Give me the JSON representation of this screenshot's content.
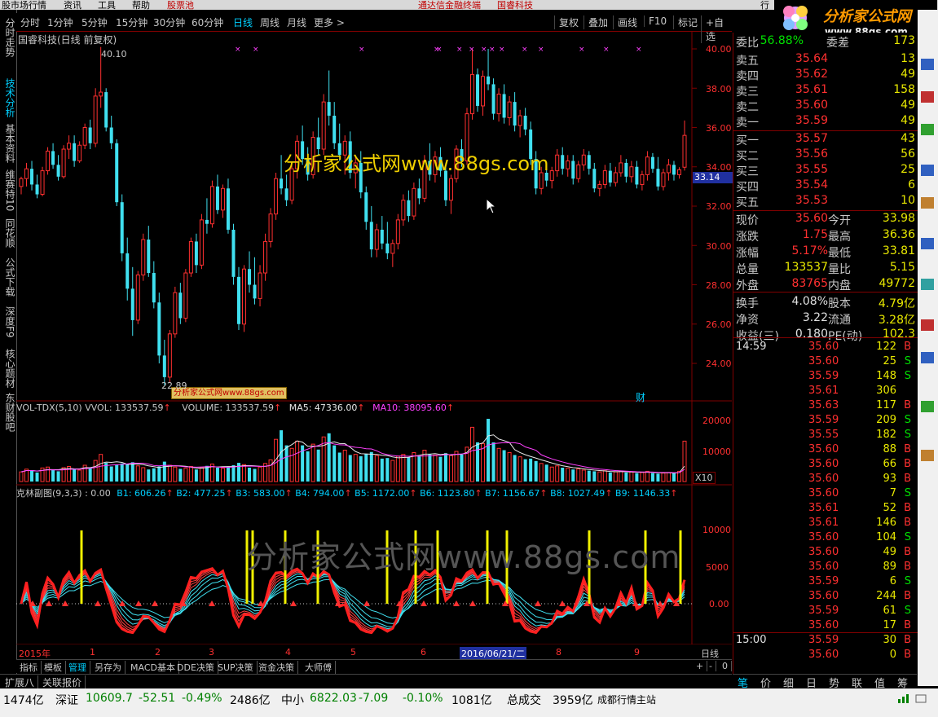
{
  "topbar": {
    "items": [
      "股市场行情",
      "资讯",
      "工具",
      "帮助",
      "股票池",
      "通达信金融终端",
      "国睿科技",
      "行"
    ]
  },
  "lefttabs": [
    "分时走势",
    "技术分析",
    "基本资料",
    "维赛特10",
    "同花顺",
    "公式下载",
    "深度F9",
    "核心题材",
    "东财股吧"
  ],
  "periods": [
    "分时",
    "1分钟",
    "5分钟",
    "15分钟",
    "30分钟",
    "60分钟",
    "日线",
    "周线",
    "月线",
    "更多 >"
  ],
  "rightbtns": [
    "复权",
    "叠加",
    "画线",
    "F10",
    "标记",
    "+自选"
  ],
  "stock_title": "国睿科技(日线 前复权)",
  "watermark": "分析家公式网www.88gs.com",
  "watermark_bottom": "分析家公式网www.88gs.com",
  "small_watermark": "分析家公式网www.88gs.com",
  "price_axis": [
    "40.00",
    "38.00",
    "36.00",
    "34.00",
    "32.00",
    "30.00",
    "28.00",
    "26.00",
    "24.00"
  ],
  "current_price_tag": "33.14",
  "high_mark": "40.10",
  "low_mark": "22.89",
  "cai_label": "财",
  "vol_header": {
    "name": "VOL-TDX(5,10)",
    "vvol": "VVOL: 133537.59",
    "volume": "VOLUME: 133537.59",
    "ma5": "MA5: 47336.00",
    "ma10": "MA10: 38095.60"
  },
  "vol_axis": [
    "20000",
    "10000"
  ],
  "vol_unit": "X10",
  "kl_header": {
    "name": "克林副图(9,3,3)",
    "p0": ": 0.00",
    "b": [
      "B1: 606.26",
      "B2: 477.25",
      "B3: 583.00",
      "B4: 794.00",
      "B5: 1172.00",
      "B6: 1123.80",
      "B7: 1156.67",
      "B8: 1027.49",
      "B9: 1146.33"
    ]
  },
  "kl_axis": [
    "10000",
    "5000",
    "0.00"
  ],
  "date_axis": [
    "2015年",
    "1",
    "2",
    "3",
    "4",
    "5",
    "6",
    "2016/06/21/二",
    "8",
    "9"
  ],
  "period_label": "日线",
  "bottom_tabs": [
    "指标",
    "模板",
    "管理",
    "另存为",
    "MACD基本",
    "DDE决策",
    "SUP决策",
    "资金决策",
    "大师傅"
  ],
  "bottom_ctrl": [
    "+",
    "-",
    "0"
  ],
  "bottom2": [
    "扩展八",
    "关联报价"
  ],
  "right_bottom_tabs": [
    "笔",
    "价",
    "细",
    "日",
    "势",
    "联",
    "值",
    "筹"
  ],
  "quote": {
    "weibi_label": "委比",
    "weibi": "56.88%",
    "weicha_label": "委差",
    "weicha": "173",
    "sells": [
      {
        "l": "卖五",
        "p": "35.64",
        "v": "13"
      },
      {
        "l": "卖四",
        "p": "35.62",
        "v": "49"
      },
      {
        "l": "卖三",
        "p": "35.61",
        "v": "158"
      },
      {
        "l": "卖二",
        "p": "35.60",
        "v": "49"
      },
      {
        "l": "卖一",
        "p": "35.59",
        "v": "49"
      }
    ],
    "buys": [
      {
        "l": "买一",
        "p": "35.57",
        "v": "43"
      },
      {
        "l": "买二",
        "p": "35.56",
        "v": "56"
      },
      {
        "l": "买三",
        "p": "35.55",
        "v": "25"
      },
      {
        "l": "买四",
        "p": "35.54",
        "v": "6"
      },
      {
        "l": "买五",
        "p": "35.53",
        "v": "10"
      }
    ],
    "stats": [
      {
        "l1": "现价",
        "v1": "35.60",
        "l2": "今开",
        "v2": "33.98"
      },
      {
        "l1": "涨跌",
        "v1": "1.75",
        "l2": "最高",
        "v2": "36.36"
      },
      {
        "l1": "涨幅",
        "v1": "5.17%",
        "l2": "最低",
        "v2": "33.81"
      },
      {
        "l1": "总量",
        "v1": "133537",
        "l2": "量比",
        "v2": "5.15"
      },
      {
        "l1": "外盘",
        "v1": "83765",
        "l2": "内盘",
        "v2": "49772"
      },
      {
        "l1": "换手",
        "v1": "4.08%",
        "l2": "股本",
        "v2": "4.79亿"
      },
      {
        "l1": "净资",
        "v1": "3.22",
        "l2": "流通",
        "v2": "3.28亿"
      },
      {
        "l1": "收益(三)",
        "v1": "0.180",
        "l2": "PE(动)",
        "v2": "102.3"
      }
    ],
    "time1": "14:59",
    "ticks": [
      [
        "35.60",
        "122",
        "B"
      ],
      [
        "35.60",
        "25",
        "S"
      ],
      [
        "35.59",
        "148",
        "S"
      ],
      [
        "35.61",
        "306",
        ""
      ],
      [
        "35.63",
        "117",
        "B"
      ],
      [
        "35.59",
        "209",
        "S"
      ],
      [
        "35.55",
        "182",
        "S"
      ],
      [
        "35.60",
        "88",
        "B"
      ],
      [
        "35.60",
        "66",
        "B"
      ],
      [
        "35.60",
        "93",
        "B"
      ],
      [
        "35.60",
        "7",
        "S"
      ],
      [
        "35.61",
        "52",
        "B"
      ],
      [
        "35.61",
        "146",
        "B"
      ],
      [
        "35.60",
        "104",
        "S"
      ],
      [
        "35.60",
        "49",
        "B"
      ],
      [
        "35.60",
        "89",
        "B"
      ],
      [
        "35.59",
        "6",
        "S"
      ],
      [
        "35.60",
        "244",
        "B"
      ],
      [
        "35.59",
        "61",
        "S"
      ],
      [
        "35.60",
        "17",
        "B"
      ]
    ],
    "time2": "15:00",
    "ticks2": [
      [
        "35.59",
        "30",
        "B"
      ],
      [
        "35.60",
        "0",
        "B"
      ]
    ]
  },
  "logo": {
    "text": "分析家公式网",
    "url": "www.88gs.com"
  },
  "status": {
    "v1": "1474亿",
    "sz_label": "深证",
    "sz": "10609.7",
    "sz_chg": "-52.51",
    "sz_pct": "-0.49%",
    "sz_amt": "2486亿",
    "zx_label": "中小",
    "zx": "6822.03",
    "zx_chg": "-7.09",
    "zx_pct": "-0.10%",
    "zx_amt": "1081亿",
    "total_label": "总成交",
    "total": "3959亿",
    "station": "成都行情主站"
  },
  "candles": [
    [
      33.0,
      33.5,
      32.6,
      33.4
    ],
    [
      33.4,
      34.2,
      33.0,
      33.9
    ],
    [
      33.9,
      34.3,
      32.8,
      33.1
    ],
    [
      33.1,
      33.6,
      32.4,
      32.6
    ],
    [
      32.6,
      34.0,
      32.5,
      33.8
    ],
    [
      33.8,
      35.0,
      33.6,
      34.8
    ],
    [
      34.8,
      35.2,
      33.9,
      34.1
    ],
    [
      34.1,
      34.6,
      33.3,
      33.5
    ],
    [
      33.5,
      35.1,
      33.4,
      34.9
    ],
    [
      34.9,
      35.6,
      34.4,
      35.2
    ],
    [
      35.2,
      35.6,
      34.0,
      34.3
    ],
    [
      34.3,
      35.3,
      34.2,
      35.1
    ],
    [
      35.1,
      36.2,
      34.9,
      36.0
    ],
    [
      36.0,
      36.4,
      34.9,
      35.2
    ],
    [
      35.2,
      38.0,
      35.0,
      37.6
    ],
    [
      37.6,
      40.1,
      37.0,
      37.8
    ],
    [
      37.8,
      38.0,
      35.8,
      36.0
    ],
    [
      36.0,
      36.6,
      34.9,
      35.2
    ],
    [
      35.2,
      35.4,
      32.0,
      32.2
    ],
    [
      32.2,
      32.6,
      29.2,
      29.6
    ],
    [
      29.6,
      30.4,
      27.2,
      27.8
    ],
    [
      27.8,
      28.9,
      25.4,
      26.2
    ],
    [
      26.2,
      28.7,
      26.0,
      28.5
    ],
    [
      28.5,
      30.6,
      28.2,
      30.3
    ],
    [
      30.3,
      31.0,
      28.4,
      28.6
    ],
    [
      28.6,
      29.2,
      26.8,
      27.1
    ],
    [
      27.1,
      27.6,
      24.0,
      24.4
    ],
    [
      24.4,
      25.2,
      22.89,
      23.3
    ],
    [
      23.3,
      25.7,
      23.0,
      25.5
    ],
    [
      25.5,
      27.9,
      25.3,
      27.6
    ],
    [
      27.6,
      28.1,
      26.0,
      26.3
    ],
    [
      26.3,
      28.8,
      26.1,
      28.6
    ],
    [
      28.6,
      30.4,
      28.4,
      30.2
    ],
    [
      30.2,
      30.6,
      28.6,
      29.0
    ],
    [
      29.0,
      31.6,
      28.8,
      31.3
    ],
    [
      31.3,
      32.4,
      30.6,
      31.1
    ],
    [
      31.1,
      33.3,
      30.9,
      33.0
    ],
    [
      33.0,
      33.6,
      31.6,
      31.8
    ],
    [
      31.8,
      33.1,
      31.4,
      32.9
    ],
    [
      32.9,
      33.4,
      30.6,
      30.8
    ],
    [
      30.8,
      31.1,
      28.0,
      28.4
    ],
    [
      28.4,
      28.9,
      25.7,
      26.0
    ],
    [
      26.0,
      29.0,
      25.6,
      28.8
    ],
    [
      28.8,
      29.7,
      27.6,
      28.0
    ],
    [
      28.0,
      29.4,
      27.0,
      27.3
    ],
    [
      27.3,
      29.0,
      26.9,
      28.6
    ],
    [
      28.6,
      30.6,
      28.2,
      30.2
    ],
    [
      30.2,
      31.9,
      29.9,
      31.6
    ],
    [
      31.6,
      33.7,
      31.3,
      33.4
    ],
    [
      33.4,
      34.6,
      32.6,
      32.9
    ],
    [
      32.9,
      33.6,
      32.0,
      32.3
    ],
    [
      32.3,
      34.2,
      32.1,
      33.9
    ],
    [
      33.9,
      35.6,
      33.4,
      35.3
    ],
    [
      35.3,
      36.1,
      34.1,
      34.4
    ],
    [
      34.4,
      35.0,
      33.3,
      33.6
    ],
    [
      33.6,
      35.8,
      33.4,
      35.5
    ],
    [
      35.5,
      36.5,
      34.6,
      34.9
    ],
    [
      34.9,
      37.7,
      34.6,
      37.3
    ],
    [
      37.3,
      38.9,
      36.1,
      36.6
    ],
    [
      36.6,
      37.3,
      34.9,
      35.2
    ],
    [
      35.2,
      36.2,
      34.3,
      34.6
    ],
    [
      34.6,
      35.6,
      33.6,
      35.3
    ],
    [
      35.3,
      35.8,
      33.4,
      33.7
    ],
    [
      33.7,
      34.6,
      32.9,
      34.2
    ],
    [
      34.2,
      34.8,
      32.4,
      32.7
    ],
    [
      32.7,
      33.0,
      30.8,
      31.2
    ],
    [
      31.2,
      32.0,
      29.4,
      29.8
    ],
    [
      29.8,
      31.1,
      29.4,
      30.8
    ],
    [
      30.8,
      31.5,
      29.8,
      30.1
    ],
    [
      30.1,
      31.2,
      29.3,
      29.6
    ],
    [
      29.6,
      30.3,
      28.9,
      30.1
    ],
    [
      30.1,
      31.6,
      29.8,
      31.3
    ],
    [
      31.3,
      32.6,
      31.0,
      32.3
    ],
    [
      32.3,
      32.8,
      31.2,
      31.5
    ],
    [
      31.5,
      33.2,
      31.3,
      32.9
    ],
    [
      32.9,
      33.4,
      32.1,
      32.4
    ],
    [
      32.4,
      34.6,
      32.2,
      34.3
    ],
    [
      34.3,
      35.2,
      33.3,
      33.6
    ],
    [
      33.6,
      34.8,
      33.2,
      34.5
    ],
    [
      34.5,
      35.0,
      33.5,
      33.8
    ],
    [
      33.8,
      34.2,
      32.0,
      32.3
    ],
    [
      32.3,
      33.6,
      31.6,
      33.4
    ],
    [
      33.4,
      35.1,
      33.2,
      34.9
    ],
    [
      34.9,
      35.4,
      34.0,
      34.3
    ],
    [
      34.3,
      37.0,
      34.1,
      36.7
    ],
    [
      36.7,
      40.0,
      36.4,
      38.7
    ],
    [
      38.7,
      39.0,
      36.8,
      37.1
    ],
    [
      37.1,
      38.9,
      36.6,
      38.6
    ],
    [
      38.6,
      40.0,
      37.9,
      38.2
    ],
    [
      38.2,
      38.5,
      36.4,
      36.7
    ],
    [
      36.7,
      38.0,
      36.3,
      37.7
    ],
    [
      37.7,
      38.2,
      36.2,
      36.5
    ],
    [
      36.5,
      37.6,
      36.1,
      37.3
    ],
    [
      37.3,
      37.8,
      35.8,
      36.1
    ],
    [
      36.1,
      36.9,
      35.5,
      36.6
    ],
    [
      36.6,
      37.0,
      35.6,
      35.9
    ],
    [
      35.9,
      36.3,
      34.1,
      34.4
    ],
    [
      34.4,
      34.8,
      32.6,
      32.9
    ],
    [
      32.9,
      34.0,
      32.6,
      33.7
    ],
    [
      33.7,
      34.2,
      33.0,
      33.3
    ],
    [
      33.3,
      34.0,
      32.9,
      33.8
    ],
    [
      33.8,
      34.9,
      33.5,
      34.6
    ],
    [
      34.6,
      35.0,
      33.6,
      33.9
    ],
    [
      33.9,
      34.6,
      33.5,
      34.3
    ],
    [
      34.3,
      34.6,
      33.1,
      33.4
    ],
    [
      33.4,
      34.3,
      33.2,
      34.1
    ],
    [
      34.1,
      34.9,
      33.8,
      34.6
    ],
    [
      34.6,
      34.8,
      33.6,
      33.9
    ],
    [
      33.9,
      34.2,
      32.7,
      32.9
    ],
    [
      32.9,
      33.3,
      32.5,
      33.1
    ],
    [
      33.1,
      34.1,
      32.9,
      33.8
    ],
    [
      33.8,
      34.2,
      33.0,
      33.2
    ],
    [
      33.2,
      34.0,
      33.0,
      33.7
    ],
    [
      33.7,
      34.6,
      33.5,
      34.2
    ],
    [
      34.2,
      34.4,
      33.2,
      33.5
    ],
    [
      33.5,
      34.3,
      33.2,
      34.0
    ],
    [
      34.0,
      34.3,
      32.9,
      33.1
    ],
    [
      33.1,
      33.8,
      32.8,
      33.6
    ],
    [
      33.6,
      34.8,
      33.3,
      34.5
    ],
    [
      34.5,
      34.7,
      33.7,
      33.9
    ],
    [
      33.9,
      34.5,
      32.8,
      33.0
    ],
    [
      33.0,
      33.9,
      32.8,
      33.7
    ],
    [
      33.7,
      34.4,
      33.3,
      34.1
    ],
    [
      34.1,
      34.3,
      33.3,
      33.6
    ],
    [
      33.6,
      33.98,
      33.4,
      33.85
    ],
    [
      33.98,
      36.36,
      33.81,
      35.6
    ]
  ],
  "volumes": [
    3.2,
    4.1,
    3.6,
    3.0,
    4.5,
    4.8,
    3.9,
    3.4,
    4.6,
    5.0,
    4.2,
    3.8,
    5.4,
    4.6,
    7.0,
    9.0,
    6.2,
    5.0,
    5.6,
    6.0,
    5.8,
    6.4,
    5.2,
    4.6,
    4.0,
    4.4,
    5.0,
    6.6,
    5.4,
    4.8,
    4.2,
    4.4,
    5.0,
    4.0,
    4.6,
    5.2,
    5.8,
    4.6,
    4.4,
    4.8,
    5.4,
    6.2,
    5.6,
    4.6,
    4.2,
    4.8,
    6.0,
    7.2,
    14.0,
    17.0,
    12.0,
    11.0,
    13.4,
    12.0,
    10.0,
    12.4,
    10.6,
    14.8,
    16.0,
    12.0,
    9.6,
    10.4,
    8.8,
    9.0,
    8.4,
    9.2,
    9.8,
    8.6,
    7.6,
    7.8,
    7.0,
    8.4,
    9.0,
    8.0,
    9.6,
    8.4,
    10.4,
    9.0,
    8.8,
    8.2,
    9.4,
    8.6,
    10.0,
    9.0,
    11.4,
    18.0,
    13.0,
    12.6,
    20.8,
    13.0,
    11.0,
    10.4,
    9.6,
    8.8,
    8.2,
    7.4,
    7.6,
    6.8,
    6.0,
    5.6,
    4.8,
    5.2,
    4.6,
    4.4,
    4.0,
    4.2,
    3.8,
    3.6,
    3.4,
    3.2,
    3.6,
    3.0,
    3.2,
    3.4,
    3.0,
    3.2,
    2.8,
    3.0,
    3.4,
    2.8,
    2.6,
    2.8,
    3.0,
    2.8,
    3.4,
    13.4
  ]
}
